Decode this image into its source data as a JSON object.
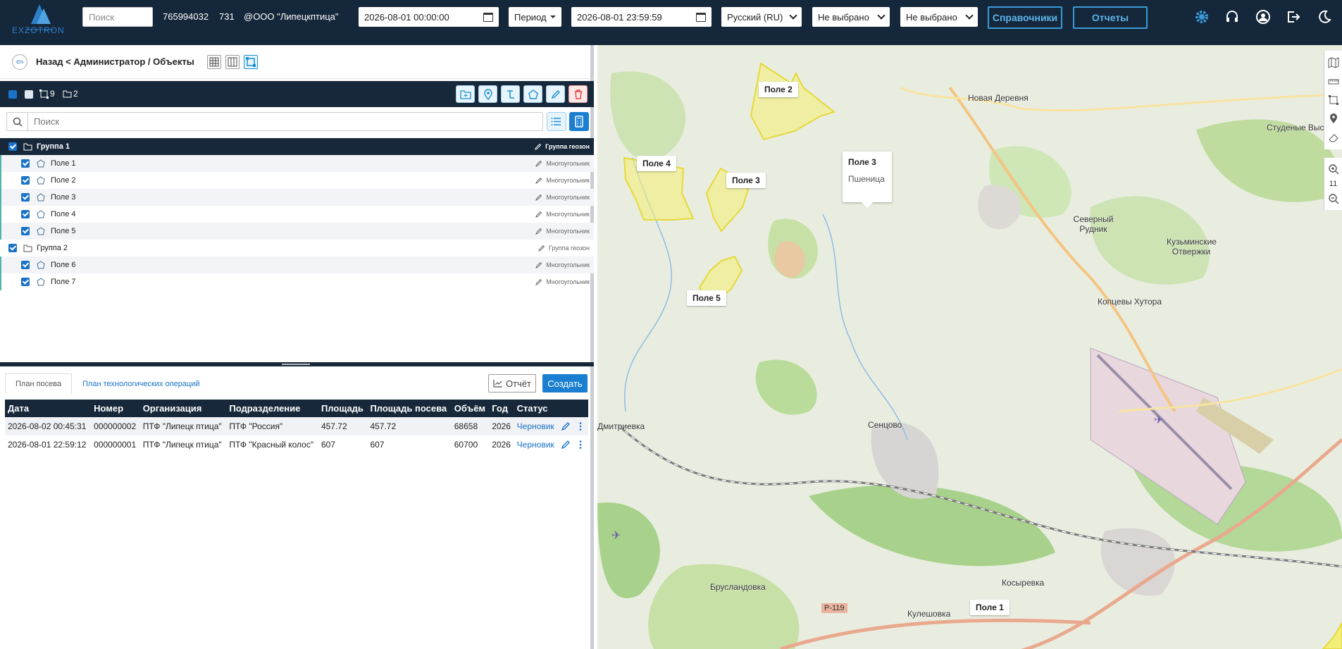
{
  "topbar": {
    "logo_text": "EXZOTRON",
    "search_placeholder": "Поиск",
    "user_id": "765994032",
    "user_code": "731",
    "company": "@ООО \"Липецкптица\"",
    "date_from": "2026-08-01 00:00:00",
    "period_label": "Период",
    "date_to": "2026-08-01 23:59:59",
    "language": "Русский (RU)",
    "filter1": "Не выбрано",
    "filter2": "Не выбрано",
    "directories_button": "Справочники",
    "reports_button": "Отчеты"
  },
  "breadcrumb": {
    "text": "Назад < Администратор / Объекты"
  },
  "geo_bar": {
    "geofence_count": "9",
    "group_count": "2"
  },
  "geo_search": {
    "placeholder": "Поиск"
  },
  "tree": {
    "group_type": "Группа геозон",
    "item_type": "Многоугольник",
    "groups": [
      {
        "name": "Группа 1",
        "items": [
          "Поле 1",
          "Поле 2",
          "Поле 3",
          "Поле 4",
          "Поле 5"
        ]
      },
      {
        "name": "Группа 2",
        "items": [
          "Поле 6",
          "Поле 7"
        ]
      }
    ]
  },
  "bottom": {
    "tabs": [
      "План посева",
      "План технологических операций"
    ],
    "report_button": "Отчёт",
    "create_button": "Создать",
    "columns": [
      "Дата",
      "Номер",
      "Организация",
      "Подразделение",
      "Площадь",
      "Площадь посева",
      "Объём",
      "Год",
      "Статус"
    ],
    "rows": [
      [
        "2026-08-02 00:45:31",
        "000000002",
        "ПТФ \"Липецк птица\"",
        "ПТФ \"Россия\"",
        "457.72",
        "457.72",
        "68658",
        "2026",
        "Черновик"
      ],
      [
        "2026-08-01 22:59:12",
        "000000001",
        "ПТФ \"Липецк птица\"",
        "ПТФ \"Красный колос\"",
        "607",
        "607",
        "60700",
        "2026",
        "Черновик"
      ]
    ]
  },
  "map": {
    "zoom": "11",
    "fields": [
      "Поле 1",
      "Поле 2",
      "Поле 3",
      "Поле 4",
      "Поле 5"
    ],
    "popup_title": "Поле 3",
    "popup_crop": "Пшеница",
    "towns": [
      "Новая Деревня",
      "Студеные Выселки",
      "Северный Рудник",
      "Кузьминские Отвержки",
      "Копцевы Хутора",
      "Сенцово",
      "Дмитриевка",
      "Брусландовка",
      "Кулешовка",
      "Косыревка",
      "Р-119"
    ]
  },
  "colors": {
    "navbar": "#15273a",
    "accent": "#1a7fd0",
    "field_fill": "#f3ee7a"
  }
}
